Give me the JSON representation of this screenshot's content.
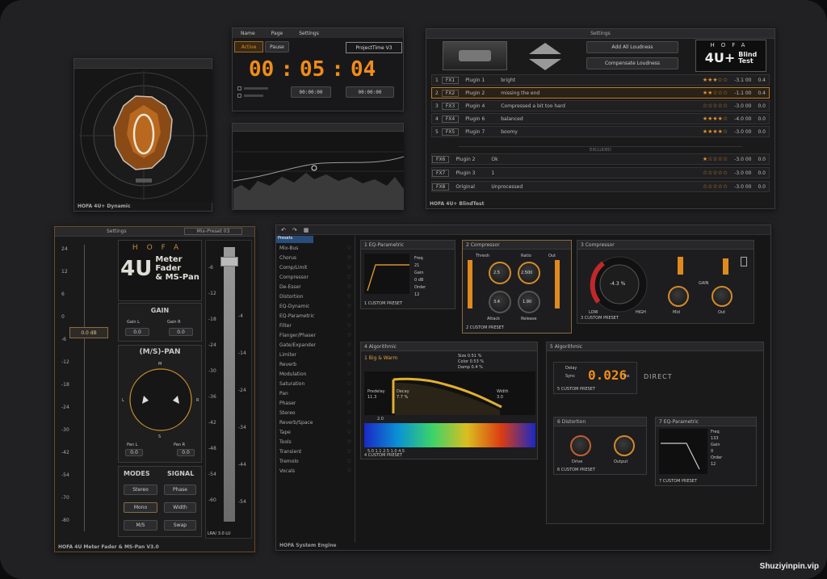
{
  "dev": {
    "footer": "HOFA 4U+ Dynamic"
  },
  "timer": {
    "menu": [
      "Name",
      "Page",
      "Settings"
    ],
    "top_right": "ProjectTime V3",
    "active": "Active",
    "pause": "Pause",
    "time": [
      "00",
      "05",
      "04"
    ],
    "small_readouts": [
      "00:00:00",
      "00:00:00"
    ]
  },
  "blindtest": {
    "title": "Settings",
    "brand": "HOFA",
    "product": "4U+",
    "product_sub1": "Blind",
    "product_sub2": "Test",
    "buttons": [
      "Add All Loudness",
      "Compensate Loudness"
    ],
    "divider": "EXCLUDED",
    "footer": "HOFA 4U+ BlindTest",
    "rows": [
      {
        "num": "1",
        "tag": "FX1",
        "name": "Plugin 1",
        "note": "bright",
        "stars": "★★★☆☆",
        "db": "-3.1 00",
        "v": "0.4"
      },
      {
        "num": "2",
        "tag": "FX2",
        "name": "Plugin 2",
        "note": "missing the end",
        "stars": "★★☆☆☆",
        "db": "-1.1 00",
        "v": "0.4"
      },
      {
        "num": "3",
        "tag": "FX3",
        "name": "Plugin 4",
        "note": "Compressed a bit too hard",
        "stars": "☆☆☆☆☆",
        "db": "-3.0 00",
        "v": "0.0"
      },
      {
        "num": "4",
        "tag": "FX4",
        "name": "Plugin 6",
        "note": "balanced",
        "stars": "★★★★☆",
        "db": "-4.0 00",
        "v": "0.0"
      },
      {
        "num": "5",
        "tag": "FX5",
        "name": "Plugin 7",
        "note": "boomy",
        "stars": "★★★★☆",
        "db": "-3.0 00",
        "v": "0.0"
      }
    ],
    "excluded_rows": [
      {
        "tag": "FX6",
        "name": "Plugin 2",
        "note": "Ok",
        "stars": "★☆☆☆☆",
        "db": "-3.0 00",
        "v": "0.0"
      },
      {
        "tag": "FX7",
        "name": "Plugin 3",
        "note": "1",
        "stars": "☆☆☆☆☆",
        "db": "-3.0 00",
        "v": "0.0"
      },
      {
        "tag": "FX8",
        "name": "Original",
        "note": "Unprocessed",
        "stars": "☆☆☆☆☆",
        "db": "-3.0 00",
        "v": "0.0"
      }
    ]
  },
  "meter": {
    "title": "Settings",
    "preset": "Mix-Preset 03",
    "brand": "HOFA",
    "product_big": "4U",
    "product_lines": [
      "Meter",
      "Fader",
      "& MS-Pan"
    ],
    "fader_value": "0.0 dB",
    "fader_ticks": [
      "24",
      "12",
      "6",
      "0",
      "-6",
      "-12",
      "-18",
      "-24",
      "-30",
      "-42",
      "-54",
      "-70",
      "-80"
    ],
    "gain_title": "GAIN",
    "gain_left_label": "Gain L",
    "gain_left_value": "0.0",
    "gain_right_label": "Gain R",
    "gain_right_value": "0.0",
    "pan_title": "(M/S)-PAN",
    "pan_letters": [
      "M",
      "L",
      "R",
      "S"
    ],
    "pan_left_label": "Pan L",
    "pan_left_value": "0.0",
    "pan_right_label": "Pan R",
    "pan_right_value": "0.0",
    "modes_title": "MODES",
    "signal_title": "SIGNAL",
    "mode_buttons": [
      "Stereo",
      "Mono",
      "Phase",
      "Width",
      "M/S",
      "Swap"
    ],
    "meter_ticks": [
      "-6",
      "-12",
      "-18",
      "-24",
      "-30",
      "-36",
      "-42",
      "-48",
      "-54",
      "-60"
    ],
    "meter_ticks_b": [
      "-4",
      "-14",
      "-24",
      "-34",
      "-44",
      "-54"
    ],
    "lufs": "LRA/ 3.0 LU",
    "footer": "HOFA 4U Meter Fader & MS-Pan V3.0"
  },
  "fx": {
    "tab": "Presets",
    "list": [
      "Mix-Bus",
      "Chorus",
      "Comp/Limit",
      "Compressor",
      "De-Esser",
      "Distortion",
      "EQ-Dynamic",
      "EQ-Parametric",
      "Filter",
      "Flanger/Phaser",
      "Gate/Expander",
      "Limiter",
      "Reverb",
      "Modulation",
      "Saturation",
      "Pan",
      "Phaser",
      "Stereo",
      "Reverb/Space",
      "Tape",
      "Tools",
      "Transient",
      "Tremolo",
      "Vocals"
    ],
    "pane1_title": "1  EQ-Parametric",
    "pane1_labels": [
      "Freq",
      "Gain",
      "Order"
    ],
    "pane1_values": [
      "21",
      "12 Hz",
      "0 dB",
      "12"
    ],
    "pane1_foot": "1 CUSTOM PRESET",
    "pane2_title": "2  Compressor",
    "pane2_labels": [
      "Thresh",
      "Ratio",
      "Out",
      "Attack",
      "Release"
    ],
    "pane2_values": [
      "2.5",
      "2.500",
      "3.4",
      "1.90"
    ],
    "pane2_foot": "2 CUSTOM PRESET",
    "pane3_title": "3  Compressor",
    "pane3_value": "-4.3 %",
    "pane3_labels": [
      "LOW",
      "HIGH",
      "GAIN",
      "Mid",
      "Out"
    ],
    "pane3_foot": "3 CUSTOM PRESET",
    "pane4_title": "4  Algorithmic",
    "pane4_sub": "1  Big & Warm",
    "pane4_info": [
      "Size 0.51 %",
      "Color 0.53 %",
      "Damp 0.4 %"
    ],
    "pane4_labels": [
      "Predelay",
      "Decay",
      "Color",
      "Width"
    ],
    "pane4_values": [
      "11.3",
      "7.7 %",
      "0.3",
      "3.0"
    ],
    "pane4_time": "2.0",
    "pane4_ruler": "5.0  1.1  2.5  1.0  4.5",
    "pane4_foot": "4 CUSTOM PRESET",
    "pane5_title": "5  Algorithmic",
    "pane5_labels": [
      "Delay",
      "Sync"
    ],
    "pane5_value": "0.026",
    "pane5_unit": "ms",
    "pane5_direct": "DIRECT",
    "pane5_foot": "5 CUSTOM PRESET",
    "pane6_title": "6  Distortion",
    "pane6_labels": [
      "Drive",
      "Output"
    ],
    "pane6_foot": "6 CUSTOM PRESET",
    "pane7_title": "7  EQ-Parametric",
    "pane7_labels": [
      "Freq",
      "Gain",
      "Order"
    ],
    "pane7_values": [
      "133",
      "0",
      "12"
    ],
    "pane7_foot": "7 CUSTOM PRESET",
    "footer": "HOFA System Engine"
  },
  "watermark": "Shuziyinpin.vip"
}
